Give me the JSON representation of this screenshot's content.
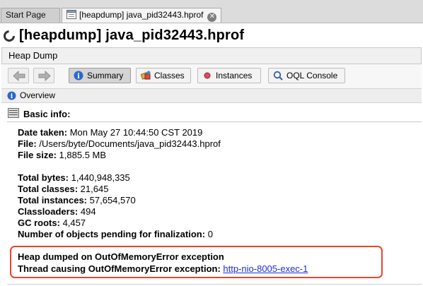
{
  "tabs": [
    {
      "label": "Start Page"
    },
    {
      "label": "[heapdump] java_pid32443.hprof"
    }
  ],
  "window_title": "[heapdump] java_pid32443.hprof",
  "section_header": "Heap Dump",
  "toolbar": {
    "summary": "Summary",
    "classes": "Classes",
    "instances": "Instances",
    "oql": "OQL Console"
  },
  "overview_label": "Overview",
  "basic_info": {
    "title": "Basic info:",
    "date_label": "Date taken:",
    "date_value": "Mon May 27 10:44:50 CST 2019",
    "file_label": "File:",
    "file_value": "/Users/byte/Documents/java_pid32443.hprof",
    "size_label": "File size:",
    "size_value": "1,885.5 MB",
    "total_bytes_label": "Total bytes:",
    "total_bytes_value": "1,440,948,335",
    "total_classes_label": "Total classes:",
    "total_classes_value": "21,645",
    "total_instances_label": "Total instances:",
    "total_instances_value": "57,654,570",
    "classloaders_label": "Classloaders:",
    "classloaders_value": "494",
    "gc_roots_label": "GC roots:",
    "gc_roots_value": "4,457",
    "pending_label": "Number of objects pending for finalization:",
    "pending_value": "0",
    "oom_line": "Heap dumped on OutOfMemoryError exception",
    "thread_label": "Thread causing OutOfMemoryError exception:",
    "thread_link": "http-nio-8005-exec-1"
  },
  "colors": {
    "highlight_border": "#e8452c",
    "link": "#1a2ee0"
  }
}
